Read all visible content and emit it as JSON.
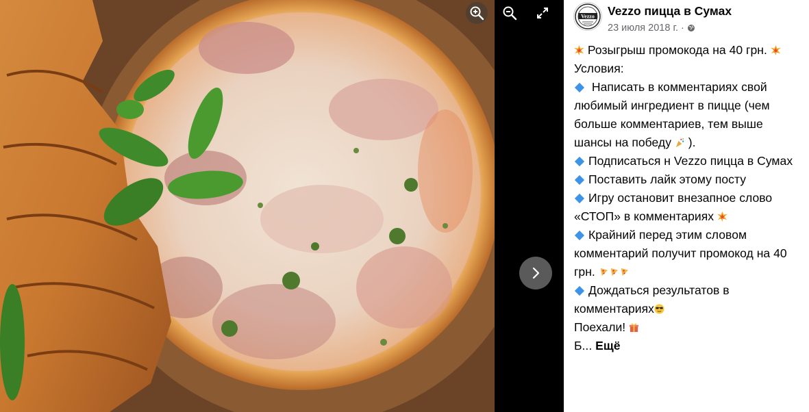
{
  "viewer": {
    "icons": [
      "zoom-in-icon",
      "zoom-out-icon",
      "expand-icon",
      "chevron-right-icon"
    ]
  },
  "post": {
    "avatar_text": "Vezzo",
    "page_name": "Vezzo пицца в Сумах",
    "date": "23 июля 2018 г.",
    "separator": "·",
    "privacy_icon": "globe-icon",
    "line1": "Розыгрыш промокода на 40 грн.",
    "line2": "Условия:",
    "item1": "Написать в комментариях свой любимый ингредиент в пицце (чем больше комментариев, тем выше шансы на победу",
    "item1_end": ").",
    "item2": "Подписаться н Vezzo пицца в Сумах",
    "item3": "Поставить лайк этому посту",
    "item4": "Игру остановит внезапное слово «СТОП» в комментариях",
    "item5": "Крайний перед этим словом комментарий получит промокод на 40 грн.",
    "item6": "Дождаться результатов в комментариях",
    "line_last": "Поехали!",
    "truncated": "Б...",
    "more_label": "Ещё"
  },
  "colors": {
    "bullet": "#3d93e6",
    "text": "#050505",
    "meta": "#65676b"
  }
}
